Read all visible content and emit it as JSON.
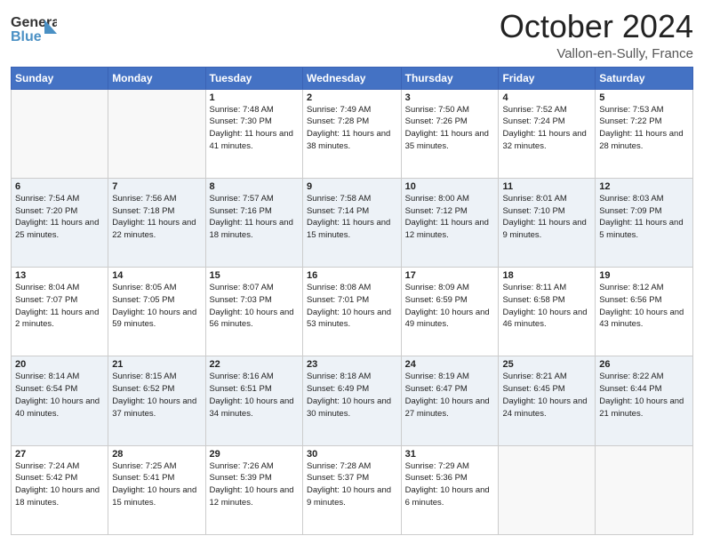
{
  "header": {
    "logo": {
      "part1": "General",
      "part2": "Blue"
    },
    "title": "October 2024",
    "location": "Vallon-en-Sully, France"
  },
  "days_of_week": [
    "Sunday",
    "Monday",
    "Tuesday",
    "Wednesday",
    "Thursday",
    "Friday",
    "Saturday"
  ],
  "weeks": [
    [
      {
        "day": "",
        "sunrise": "",
        "sunset": "",
        "daylight": ""
      },
      {
        "day": "",
        "sunrise": "",
        "sunset": "",
        "daylight": ""
      },
      {
        "day": "1",
        "sunrise": "Sunrise: 7:48 AM",
        "sunset": "Sunset: 7:30 PM",
        "daylight": "Daylight: 11 hours and 41 minutes."
      },
      {
        "day": "2",
        "sunrise": "Sunrise: 7:49 AM",
        "sunset": "Sunset: 7:28 PM",
        "daylight": "Daylight: 11 hours and 38 minutes."
      },
      {
        "day": "3",
        "sunrise": "Sunrise: 7:50 AM",
        "sunset": "Sunset: 7:26 PM",
        "daylight": "Daylight: 11 hours and 35 minutes."
      },
      {
        "day": "4",
        "sunrise": "Sunrise: 7:52 AM",
        "sunset": "Sunset: 7:24 PM",
        "daylight": "Daylight: 11 hours and 32 minutes."
      },
      {
        "day": "5",
        "sunrise": "Sunrise: 7:53 AM",
        "sunset": "Sunset: 7:22 PM",
        "daylight": "Daylight: 11 hours and 28 minutes."
      }
    ],
    [
      {
        "day": "6",
        "sunrise": "Sunrise: 7:54 AM",
        "sunset": "Sunset: 7:20 PM",
        "daylight": "Daylight: 11 hours and 25 minutes."
      },
      {
        "day": "7",
        "sunrise": "Sunrise: 7:56 AM",
        "sunset": "Sunset: 7:18 PM",
        "daylight": "Daylight: 11 hours and 22 minutes."
      },
      {
        "day": "8",
        "sunrise": "Sunrise: 7:57 AM",
        "sunset": "Sunset: 7:16 PM",
        "daylight": "Daylight: 11 hours and 18 minutes."
      },
      {
        "day": "9",
        "sunrise": "Sunrise: 7:58 AM",
        "sunset": "Sunset: 7:14 PM",
        "daylight": "Daylight: 11 hours and 15 minutes."
      },
      {
        "day": "10",
        "sunrise": "Sunrise: 8:00 AM",
        "sunset": "Sunset: 7:12 PM",
        "daylight": "Daylight: 11 hours and 12 minutes."
      },
      {
        "day": "11",
        "sunrise": "Sunrise: 8:01 AM",
        "sunset": "Sunset: 7:10 PM",
        "daylight": "Daylight: 11 hours and 9 minutes."
      },
      {
        "day": "12",
        "sunrise": "Sunrise: 8:03 AM",
        "sunset": "Sunset: 7:09 PM",
        "daylight": "Daylight: 11 hours and 5 minutes."
      }
    ],
    [
      {
        "day": "13",
        "sunrise": "Sunrise: 8:04 AM",
        "sunset": "Sunset: 7:07 PM",
        "daylight": "Daylight: 11 hours and 2 minutes."
      },
      {
        "day": "14",
        "sunrise": "Sunrise: 8:05 AM",
        "sunset": "Sunset: 7:05 PM",
        "daylight": "Daylight: 10 hours and 59 minutes."
      },
      {
        "day": "15",
        "sunrise": "Sunrise: 8:07 AM",
        "sunset": "Sunset: 7:03 PM",
        "daylight": "Daylight: 10 hours and 56 minutes."
      },
      {
        "day": "16",
        "sunrise": "Sunrise: 8:08 AM",
        "sunset": "Sunset: 7:01 PM",
        "daylight": "Daylight: 10 hours and 53 minutes."
      },
      {
        "day": "17",
        "sunrise": "Sunrise: 8:09 AM",
        "sunset": "Sunset: 6:59 PM",
        "daylight": "Daylight: 10 hours and 49 minutes."
      },
      {
        "day": "18",
        "sunrise": "Sunrise: 8:11 AM",
        "sunset": "Sunset: 6:58 PM",
        "daylight": "Daylight: 10 hours and 46 minutes."
      },
      {
        "day": "19",
        "sunrise": "Sunrise: 8:12 AM",
        "sunset": "Sunset: 6:56 PM",
        "daylight": "Daylight: 10 hours and 43 minutes."
      }
    ],
    [
      {
        "day": "20",
        "sunrise": "Sunrise: 8:14 AM",
        "sunset": "Sunset: 6:54 PM",
        "daylight": "Daylight: 10 hours and 40 minutes."
      },
      {
        "day": "21",
        "sunrise": "Sunrise: 8:15 AM",
        "sunset": "Sunset: 6:52 PM",
        "daylight": "Daylight: 10 hours and 37 minutes."
      },
      {
        "day": "22",
        "sunrise": "Sunrise: 8:16 AM",
        "sunset": "Sunset: 6:51 PM",
        "daylight": "Daylight: 10 hours and 34 minutes."
      },
      {
        "day": "23",
        "sunrise": "Sunrise: 8:18 AM",
        "sunset": "Sunset: 6:49 PM",
        "daylight": "Daylight: 10 hours and 30 minutes."
      },
      {
        "day": "24",
        "sunrise": "Sunrise: 8:19 AM",
        "sunset": "Sunset: 6:47 PM",
        "daylight": "Daylight: 10 hours and 27 minutes."
      },
      {
        "day": "25",
        "sunrise": "Sunrise: 8:21 AM",
        "sunset": "Sunset: 6:45 PM",
        "daylight": "Daylight: 10 hours and 24 minutes."
      },
      {
        "day": "26",
        "sunrise": "Sunrise: 8:22 AM",
        "sunset": "Sunset: 6:44 PM",
        "daylight": "Daylight: 10 hours and 21 minutes."
      }
    ],
    [
      {
        "day": "27",
        "sunrise": "Sunrise: 7:24 AM",
        "sunset": "Sunset: 5:42 PM",
        "daylight": "Daylight: 10 hours and 18 minutes."
      },
      {
        "day": "28",
        "sunrise": "Sunrise: 7:25 AM",
        "sunset": "Sunset: 5:41 PM",
        "daylight": "Daylight: 10 hours and 15 minutes."
      },
      {
        "day": "29",
        "sunrise": "Sunrise: 7:26 AM",
        "sunset": "Sunset: 5:39 PM",
        "daylight": "Daylight: 10 hours and 12 minutes."
      },
      {
        "day": "30",
        "sunrise": "Sunrise: 7:28 AM",
        "sunset": "Sunset: 5:37 PM",
        "daylight": "Daylight: 10 hours and 9 minutes."
      },
      {
        "day": "31",
        "sunrise": "Sunrise: 7:29 AM",
        "sunset": "Sunset: 5:36 PM",
        "daylight": "Daylight: 10 hours and 6 minutes."
      },
      {
        "day": "",
        "sunrise": "",
        "sunset": "",
        "daylight": ""
      },
      {
        "day": "",
        "sunrise": "",
        "sunset": "",
        "daylight": ""
      }
    ]
  ]
}
